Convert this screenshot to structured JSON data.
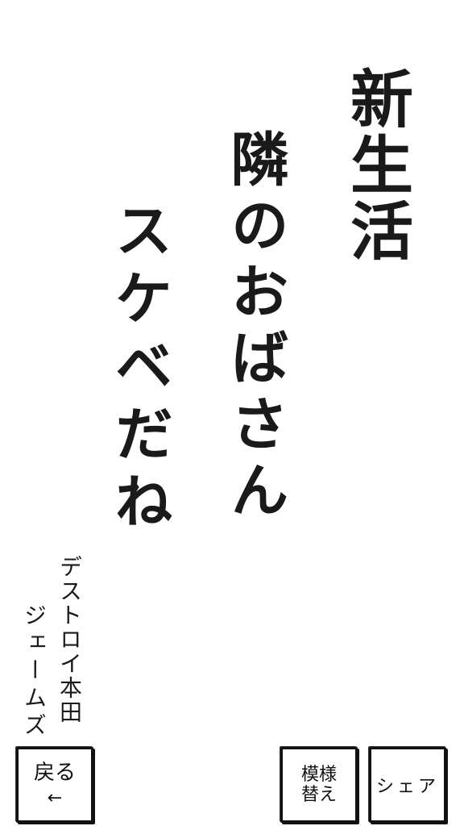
{
  "poem": {
    "line1": "新生活",
    "line2": "隣のおばさん",
    "line3": "スケベだね"
  },
  "author": {
    "line1": "デストロイ本田",
    "line2": "ジェームズ"
  },
  "buttons": {
    "back_label": "戻る",
    "back_arrow": "←",
    "pattern_label": "模様替え",
    "share_label": "シェア"
  },
  "icons": {
    "back_arrow": "arrow-left-icon"
  }
}
